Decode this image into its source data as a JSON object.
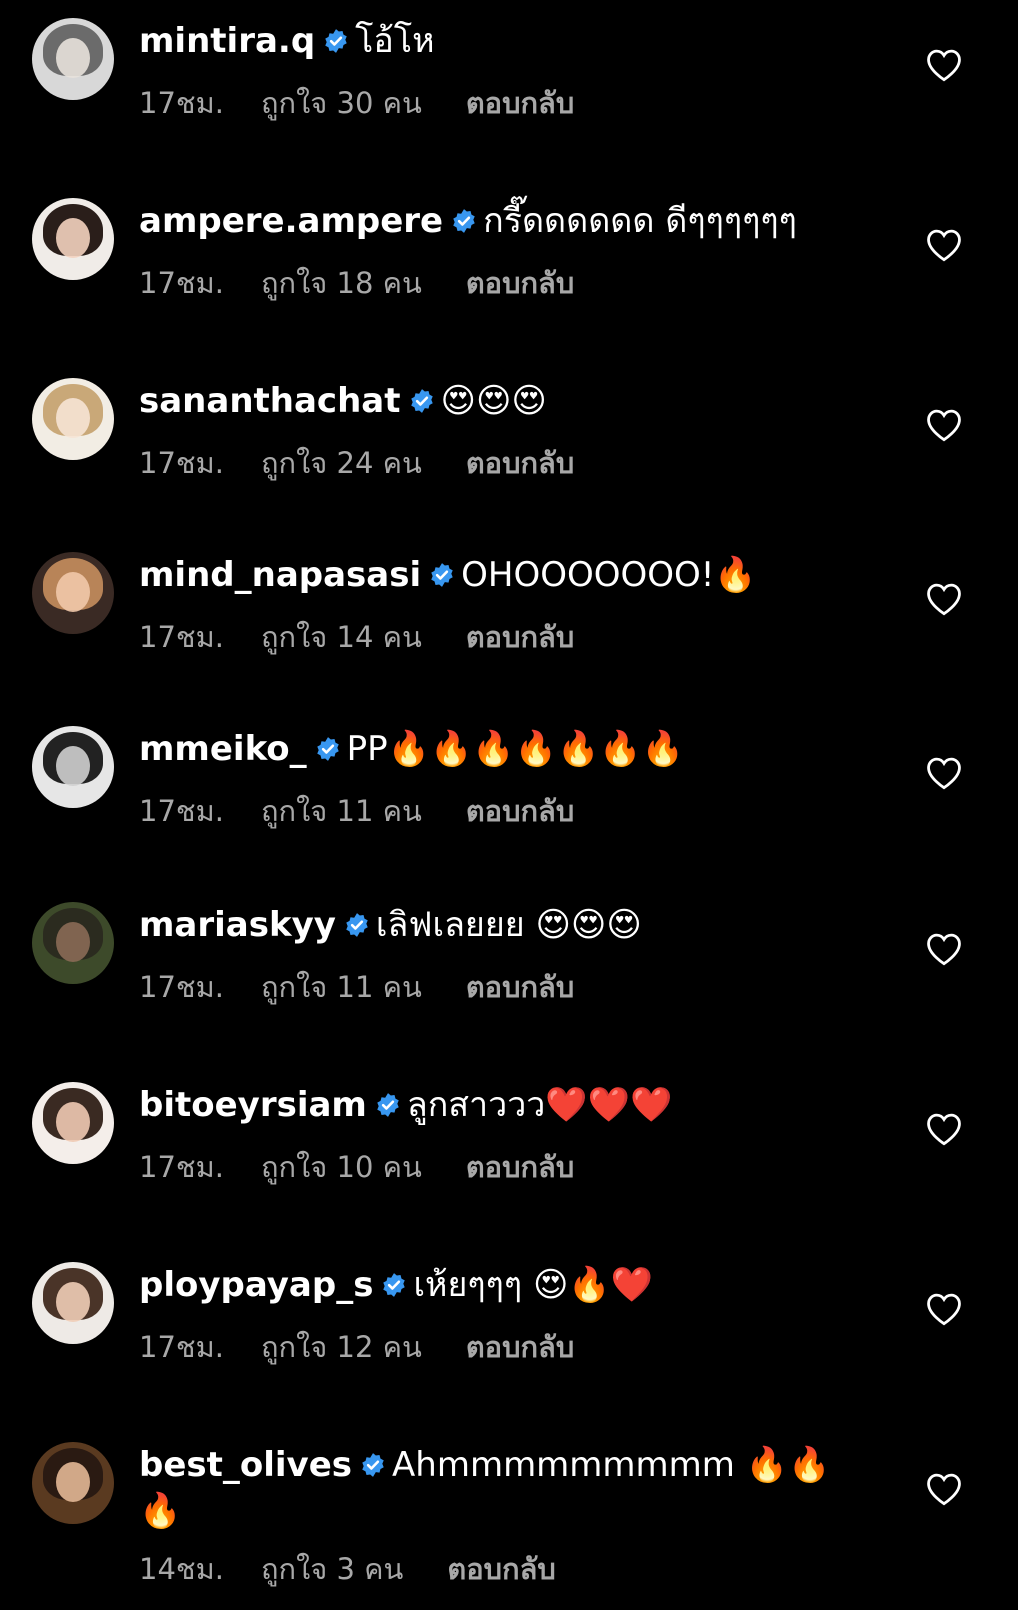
{
  "colors": {
    "background": "#000000",
    "text_primary": "#ffffff",
    "text_secondary": "#a8a8a8",
    "verified_badge": "#3897f0"
  },
  "icons": {
    "verified": "verified-badge-icon",
    "like": "heart-outline-icon"
  },
  "comments": [
    {
      "username": "mintira.q",
      "text": "โอ้โห",
      "time": "17ชม.",
      "likes": "ถูกใจ 30 คน",
      "reply": "ตอบกลับ"
    },
    {
      "username": "ampere.ampere",
      "text": "กรี๊ดดดดดด ดีๆๆๆๆๆๆ",
      "time": "17ชม.",
      "likes": "ถูกใจ 18 คน",
      "reply": "ตอบกลับ"
    },
    {
      "username": "sananthachat",
      "text": "😍😍😍",
      "time": "17ชม.",
      "likes": "ถูกใจ 24 คน",
      "reply": "ตอบกลับ"
    },
    {
      "username": "mind_napasasi",
      "text": "OHOOOOOOO!🔥",
      "time": "17ชม.",
      "likes": "ถูกใจ 14 คน",
      "reply": "ตอบกลับ"
    },
    {
      "username": "mmeiko_",
      "text": "PP🔥🔥🔥🔥🔥🔥🔥",
      "time": "17ชม.",
      "likes": "ถูกใจ 11 คน",
      "reply": "ตอบกลับ"
    },
    {
      "username": "mariaskyy",
      "text": "เลิฟเลยยย 😍😍😍",
      "time": "17ชม.",
      "likes": "ถูกใจ 11 คน",
      "reply": "ตอบกลับ"
    },
    {
      "username": "bitoeyrsiam",
      "text": "ลูกสาววว❤️❤️❤️",
      "time": "17ชม.",
      "likes": "ถูกใจ 10 คน",
      "reply": "ตอบกลับ"
    },
    {
      "username": "ploypayap_s",
      "text": "เห้ยๆๆๆ 😍🔥❤️",
      "time": "17ชม.",
      "likes": "ถูกใจ 12 คน",
      "reply": "ตอบกลับ"
    },
    {
      "username": "best_olives",
      "text": "Ahmmmmmmmmm 🔥🔥🔥",
      "time": "14ชม.",
      "likes": "ถูกใจ 3 คน",
      "reply": "ตอบกลับ"
    }
  ]
}
